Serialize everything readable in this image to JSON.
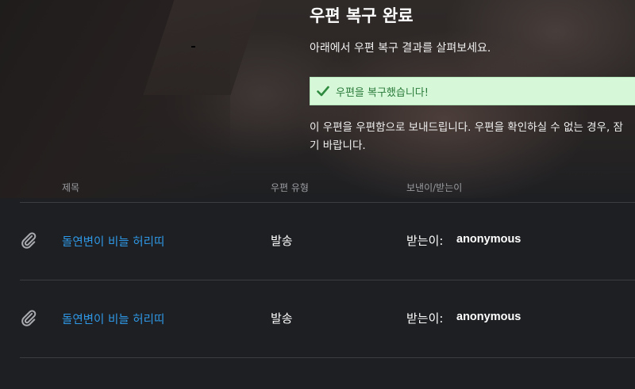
{
  "header": {
    "title": "우편 복구 완료",
    "subtitle": "아래에서 우편 복구 결과를 살펴보세요."
  },
  "alert": {
    "icon": "check-icon",
    "text": "우편을 복구했습니다!",
    "background": "#d6f8d9",
    "text_color": "#2a7a39"
  },
  "notice": {
    "line1": "이 우편을 우편함으로 보내드립니다. 우편을 확인하실 수 없는 경우, 잠",
    "line2": "기 바랍니다."
  },
  "table": {
    "columns": {
      "subject": "제목",
      "type": "우편 유형",
      "sender_recipient": "보낸이/받는이"
    },
    "rows": [
      {
        "icon": "paperclip-icon",
        "subject": "돌연변이 비늘 허리띠",
        "type": "발송",
        "recipient_label": "받는이:",
        "recipient_name": "anonymous"
      },
      {
        "icon": "paperclip-icon",
        "subject": "돌연변이 비늘 허리띠",
        "type": "발송",
        "recipient_label": "받는이:",
        "recipient_name": "anonymous"
      }
    ]
  },
  "colors": {
    "background": "#1e1f22",
    "link": "#2f98e6",
    "divider": "#3c3d41"
  }
}
